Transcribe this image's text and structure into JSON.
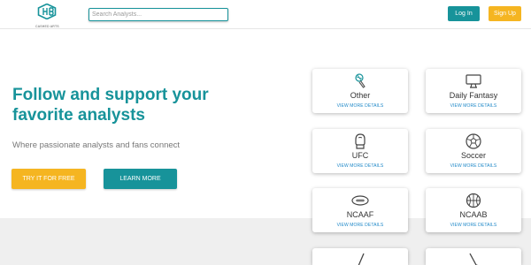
{
  "header": {
    "logo_text": "CASHED ARTS",
    "search_placeholder": "Search Analysts...",
    "login_label": "Log In",
    "signup_label": "Sign Up"
  },
  "hero": {
    "title": "Follow and support your favorite analysts",
    "subtitle": "Where passionate analysts and fans connect",
    "try_label": "TRY IT FOR FREE",
    "learn_label": "LEARN MORE"
  },
  "categories": [
    {
      "name": "Other",
      "details": "VIEW MORE DETAILS",
      "icon": "microphone-icon"
    },
    {
      "name": "Daily Fantasy",
      "details": "VIEW MORE DETAILS",
      "icon": "monitor-icon"
    },
    {
      "name": "UFC",
      "details": "VIEW MORE DETAILS",
      "icon": "boxing-glove-icon"
    },
    {
      "name": "Soccer",
      "details": "VIEW MORE DETAILS",
      "icon": "soccer-ball-icon"
    },
    {
      "name": "NCAAF",
      "details": "VIEW MORE DETAILS",
      "icon": "football-icon"
    },
    {
      "name": "NCAAB",
      "details": "VIEW MORE DETAILS",
      "icon": "basketball-icon"
    },
    {
      "name": "",
      "details": "",
      "icon": "hockey-stick-icon"
    },
    {
      "name": "",
      "details": "",
      "icon": "golf-club-icon"
    }
  ],
  "colors": {
    "teal": "#17939a",
    "yellow": "#f5b521",
    "link_blue": "#1e88c8",
    "text_gray": "#777777",
    "footer_bg": "#efefef"
  }
}
